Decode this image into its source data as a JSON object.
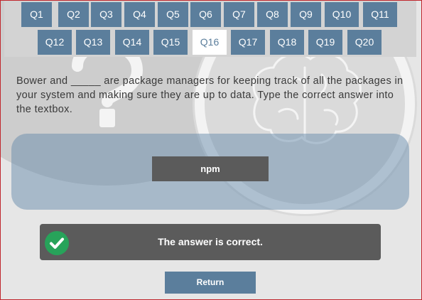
{
  "nav": {
    "questions": [
      {
        "label": "Q1"
      },
      {
        "label": "Q2"
      },
      {
        "label": "Q3"
      },
      {
        "label": "Q4"
      },
      {
        "label": "Q5"
      },
      {
        "label": "Q6"
      },
      {
        "label": "Q7"
      },
      {
        "label": "Q8"
      },
      {
        "label": "Q9"
      },
      {
        "label": "Q10"
      },
      {
        "label": "Q11"
      },
      {
        "label": "Q12"
      },
      {
        "label": "Q13"
      },
      {
        "label": "Q14"
      },
      {
        "label": "Q15"
      },
      {
        "label": "Q16",
        "active": true
      },
      {
        "label": "Q17"
      },
      {
        "label": "Q18"
      },
      {
        "label": "Q19"
      },
      {
        "label": "Q20"
      }
    ]
  },
  "question": {
    "text": "Bower and _____ are package managers for keeping track of all the packages in your system and making sure they are up to data. Type the correct answer into the textbox."
  },
  "answer": {
    "value": "npm"
  },
  "feedback": {
    "text": "The answer is correct.",
    "icon": "checkmark-icon"
  },
  "actions": {
    "return_label": "Return"
  },
  "colors": {
    "button": "#5b7e9c",
    "active_button_bg": "#ffffff",
    "nav_bar": "#d3d3d3",
    "panel": "#5b5b5b",
    "success": "#27a35a",
    "border": "#c0272d"
  }
}
